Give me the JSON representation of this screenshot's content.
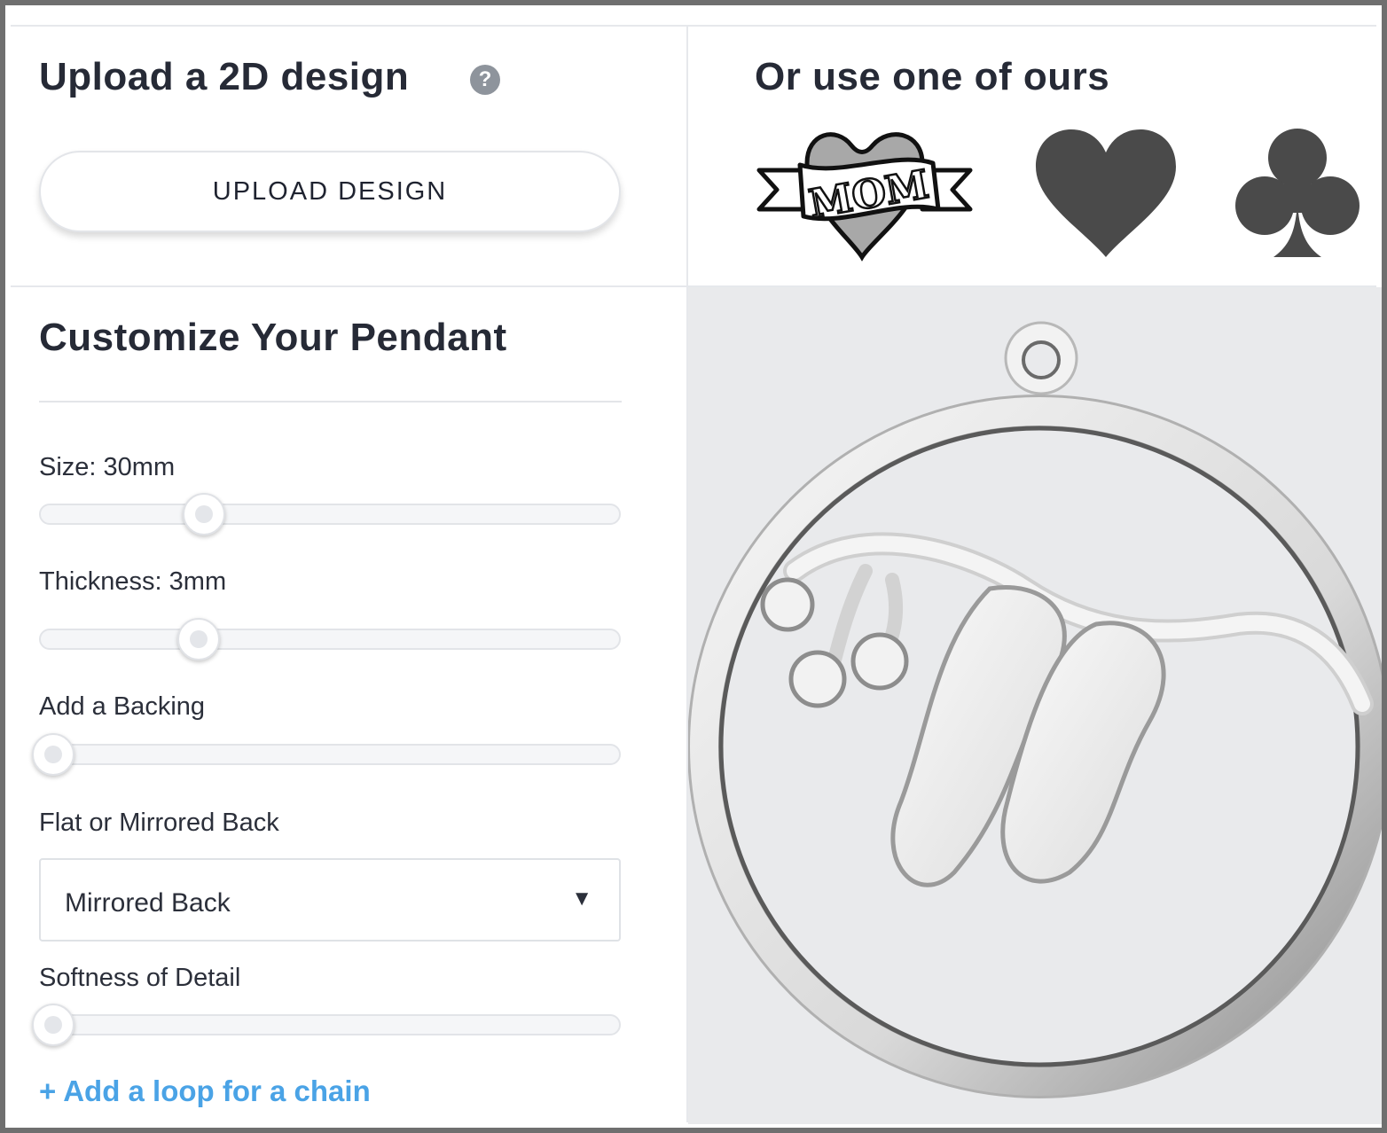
{
  "upload": {
    "title": "Upload a 2D design",
    "help_icon_glyph": "?",
    "button_label": "UPLOAD DESIGN"
  },
  "ours": {
    "title": "Or use one of ours",
    "designs": [
      {
        "icon": "mom-heart-banner-icon",
        "banner_text": "MOM"
      },
      {
        "icon": "heart-icon",
        "color": "#4a4a4a"
      },
      {
        "icon": "club-icon",
        "color": "#4a4a4a"
      }
    ]
  },
  "customize": {
    "title": "Customize Your Pendant",
    "size": {
      "label": "Size: 30mm",
      "value_fraction": 0.28
    },
    "thickness": {
      "label": "Thickness: 3mm",
      "value_fraction": 0.27
    },
    "backing": {
      "label": "Add a Backing",
      "value_fraction": 0.0
    },
    "back": {
      "label": "Flat or Mirrored Back",
      "selected": "Mirrored Back",
      "arrow_glyph": "▼"
    },
    "softness": {
      "label": "Softness of Detail",
      "value_fraction": 0.0
    },
    "add_loop_link": "+ Add a loop for a chain"
  },
  "preview": {
    "background": "#e9eaec",
    "model": "pendant-3d-preview"
  }
}
